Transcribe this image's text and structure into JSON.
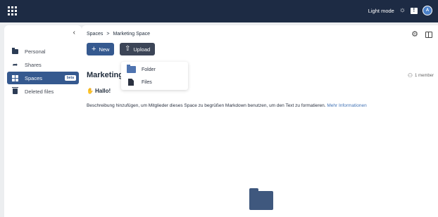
{
  "topbar": {
    "mode_label": "Light mode",
    "avatar_initial": "A",
    "icons": [
      "app-grid-icon",
      "sun-icon",
      "feedback-icon"
    ]
  },
  "sidebar": {
    "collapse_glyph": "‹",
    "items": [
      {
        "label": "Personal",
        "icon": "folder-icon",
        "active": false
      },
      {
        "label": "Shares",
        "icon": "share-icon",
        "active": false
      },
      {
        "label": "Spaces",
        "icon": "spaces-icon",
        "active": true,
        "badge": "beta"
      },
      {
        "label": "Deleted files",
        "icon": "trash-icon",
        "active": false
      }
    ]
  },
  "main": {
    "breadcrumb": [
      "Spaces",
      ">",
      "Marketing Space"
    ],
    "new_label": "New",
    "upload_label": "Upload",
    "title": "Marketing",
    "members": "1 member",
    "hello": "Hallo!",
    "description": "Beschreibung hinzufügen, um Mitglieder dieses Space zu begrüßen Markdown benutzen, um den Text zu formatieren.",
    "description_link": "Mehr Informationen"
  },
  "dropdown": {
    "items": [
      {
        "label": "Folder",
        "icon": "folder-icon"
      },
      {
        "label": "Files",
        "icon": "file-icon"
      }
    ]
  },
  "colors": {
    "topbar": "#1d2b44",
    "accent": "#35598f",
    "upload_button": "#3c4557",
    "link": "#4273b5"
  }
}
